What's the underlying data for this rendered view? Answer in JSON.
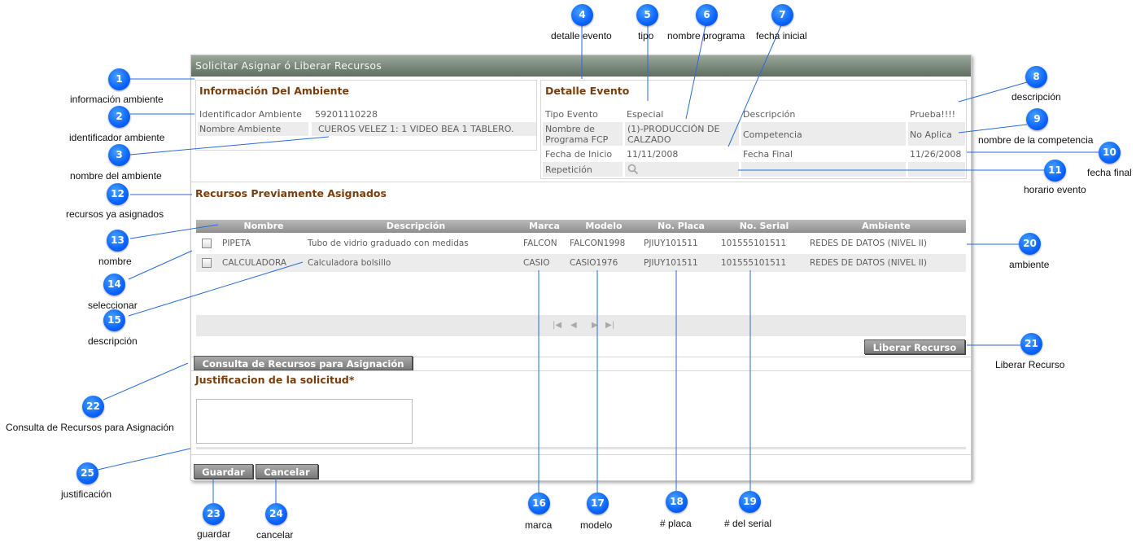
{
  "window": {
    "title": "Solicitar Asignar ó Liberar Recursos"
  },
  "ambiente": {
    "title": "Información Del Ambiente",
    "id_label": "Identificador Ambiente",
    "id_value": "59201110228",
    "name_label": "Nombre Ambiente",
    "name_value": "CUEROS VELEZ 1: 1 VIDEO BEA 1 TABLERO."
  },
  "evento": {
    "title": "Detalle Evento",
    "tipo_label": "Tipo Evento",
    "tipo_value": "Especial",
    "descripcion_label": "Descripción",
    "descripcion_value": "Prueba!!!!",
    "programa_label_1": "Nombre de",
    "programa_label_2": "Programa FCP",
    "programa_value_1": "(1)-PRODUCCIÓN DE",
    "programa_value_2": "CALZADO",
    "competencia_label": "Competencia",
    "competencia_value": "No Aplica",
    "fecha_inicio_label": "Fecha de Inicio",
    "fecha_inicio_value": "11/11/2008",
    "fecha_final_label": "Fecha Final",
    "fecha_final_value": "11/26/2008",
    "repeticion_label": "Repetición"
  },
  "recursos": {
    "title": "Recursos Previamente Asignados",
    "columns": [
      "Nombre",
      "Descripción",
      "Marca",
      "Modelo",
      "No. Placa",
      "No. Serial",
      "Ambiente"
    ],
    "rows": [
      {
        "nombre": "PIPETA",
        "descripcion": "Tubo de vidrio graduado con medidas",
        "marca": "FALCON",
        "modelo": "FALCON1998",
        "placa": "PJIUY101511",
        "serial": "101555101511",
        "ambiente": "REDES DE DATOS (NIVEL II)"
      },
      {
        "nombre": "CALCULADORA",
        "descripcion": "Calculadora bolsillo",
        "marca": "CASIO",
        "modelo": "CASIO1976",
        "placa": "PJIUY101511",
        "serial": "101555101511",
        "ambiente": "REDES DE DATOS (NIVEL II)"
      }
    ],
    "pager_icons": [
      "first-page-icon",
      "prev-page-icon",
      "next-page-icon",
      "last-page-icon"
    ]
  },
  "buttons": {
    "liberar": "Liberar Recurso",
    "consulta": "Consulta de Recursos para Asignación",
    "guardar": "Guardar",
    "cancelar": "Cancelar"
  },
  "justificacion": {
    "title": "Justificacion de la solicitud*"
  },
  "callouts": [
    {
      "n": "1",
      "label": "información ambiente"
    },
    {
      "n": "2",
      "label": "identificador ambiente"
    },
    {
      "n": "3",
      "label": "nombre del ambiente"
    },
    {
      "n": "4",
      "label": "detalle evento"
    },
    {
      "n": "5",
      "label": "tipo"
    },
    {
      "n": "6",
      "label": "nombre programa"
    },
    {
      "n": "7",
      "label": "fecha inicial"
    },
    {
      "n": "8",
      "label": "descripción"
    },
    {
      "n": "9",
      "label": "nombre de la competencia"
    },
    {
      "n": "10",
      "label": "fecha final"
    },
    {
      "n": "11",
      "label": "horario evento"
    },
    {
      "n": "12",
      "label": "recursos ya asignados"
    },
    {
      "n": "13",
      "label": "nombre"
    },
    {
      "n": "14",
      "label": "seleccionar"
    },
    {
      "n": "15",
      "label": "descripción"
    },
    {
      "n": "16",
      "label": "marca"
    },
    {
      "n": "17",
      "label": "modelo"
    },
    {
      "n": "18",
      "label": "# placa"
    },
    {
      "n": "19",
      "label": "# del serial"
    },
    {
      "n": "20",
      "label": "ambiente"
    },
    {
      "n": "21",
      "label": "Liberar Recurso"
    },
    {
      "n": "22",
      "label": "Consulta de Recursos para Asignación"
    },
    {
      "n": "23",
      "label": "guardar"
    },
    {
      "n": "24",
      "label": "cancelar"
    },
    {
      "n": "25",
      "label": "justificación"
    }
  ],
  "colors": {
    "title_bar": "#6f7d70",
    "section_title": "#7a3d0c",
    "callout": "#0a63ff",
    "button": "#8e8e8e"
  }
}
